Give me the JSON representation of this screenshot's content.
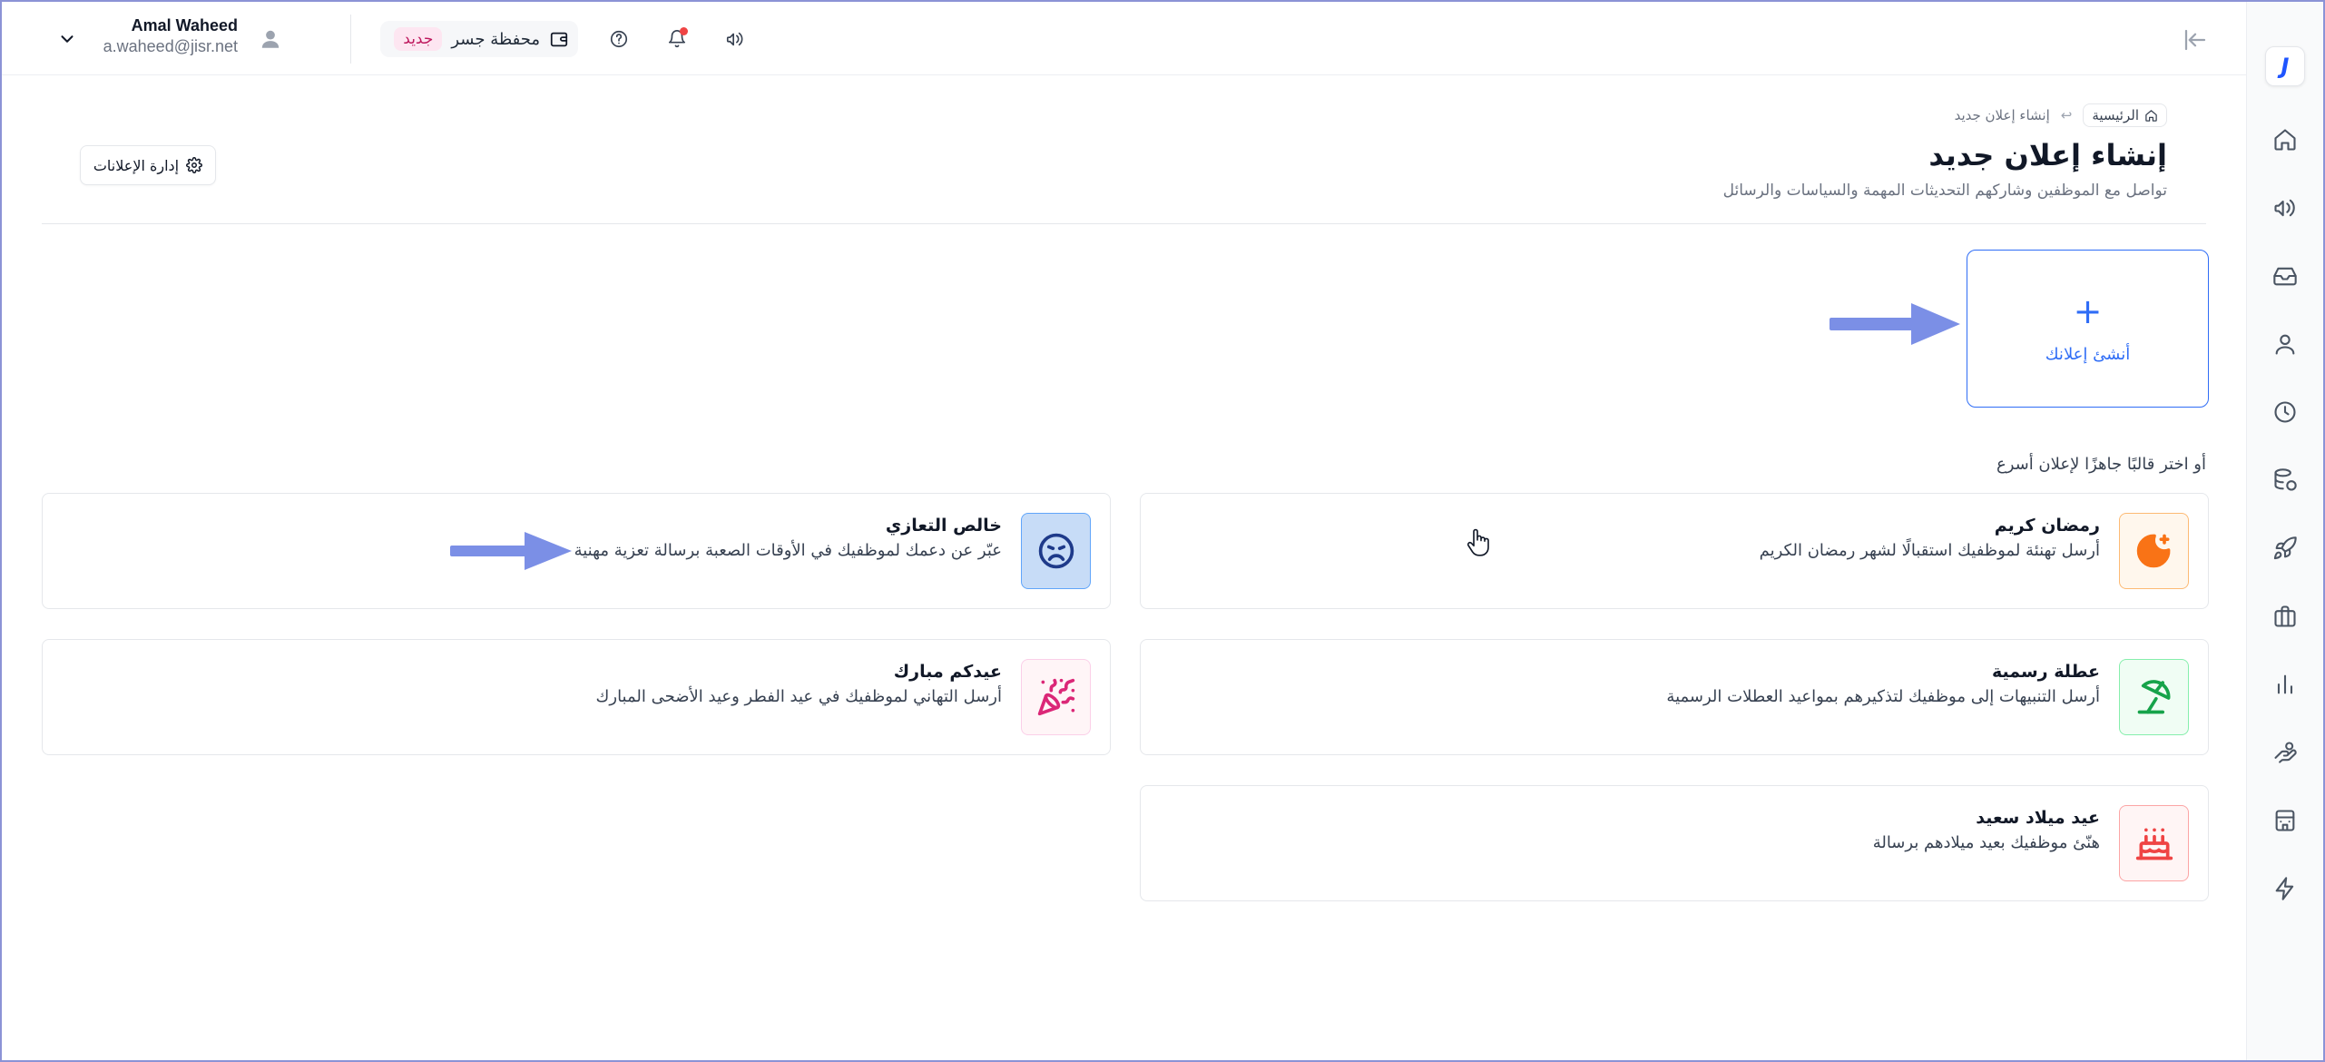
{
  "topbar": {
    "user_name": "Amal Waheed",
    "user_email": "a.waheed@jisr.net",
    "wallet_label": "محفظة جسر",
    "wallet_badge": "جديد"
  },
  "breadcrumb": {
    "home": "الرئيسية",
    "separator": "↩",
    "current": "إنشاء إعلان جديد"
  },
  "header": {
    "title": "إنشاء إعلان جديد",
    "subtitle": "تواصل مع الموظفين وشاركهم التحديثات المهمة والسياسات والرسائل",
    "manage_button": "إدارة الإعلانات"
  },
  "create_card": {
    "plus": "+",
    "label": "أنشئ إعلانك"
  },
  "templates_heading": "أو اختر قالبًا جاهزًا لإعلان أسرع",
  "templates": [
    {
      "title": "رمضان كريم",
      "desc": "أرسل تهنئة لموظفيك استقبالًا لشهر رمضان الكريم",
      "icon": "moon-star-icon",
      "color": "#f97316"
    },
    {
      "title": "خالص التعازي",
      "desc": "عبّر عن دعمك لموظفيك في الأوقات الصعبة برسالة تعزية مهنية",
      "icon": "sad-face-icon",
      "color": "#1e3a8a"
    },
    {
      "title": "عطلة رسمية",
      "desc": "أرسل التنبيهات إلى موظفيك لتذكيرهم بمواعيد العطلات الرسمية",
      "icon": "beach-umbrella-icon",
      "color": "#16a34a"
    },
    {
      "title": "عيدكم مبارك",
      "desc": "أرسل التهاني لموظفيك في عيد الفطر وعيد الأضحى المبارك",
      "icon": "party-popper-icon",
      "color": "#db2777"
    },
    {
      "title": "عيد ميلاد سعيد",
      "desc": "هنّئ موظفيك بعيد ميلادهم برسالة",
      "icon": "birthday-cake-icon",
      "color": "#ef4444"
    }
  ],
  "colors": {
    "accent": "#2f6df6",
    "arrow": "#7b8fe6"
  }
}
